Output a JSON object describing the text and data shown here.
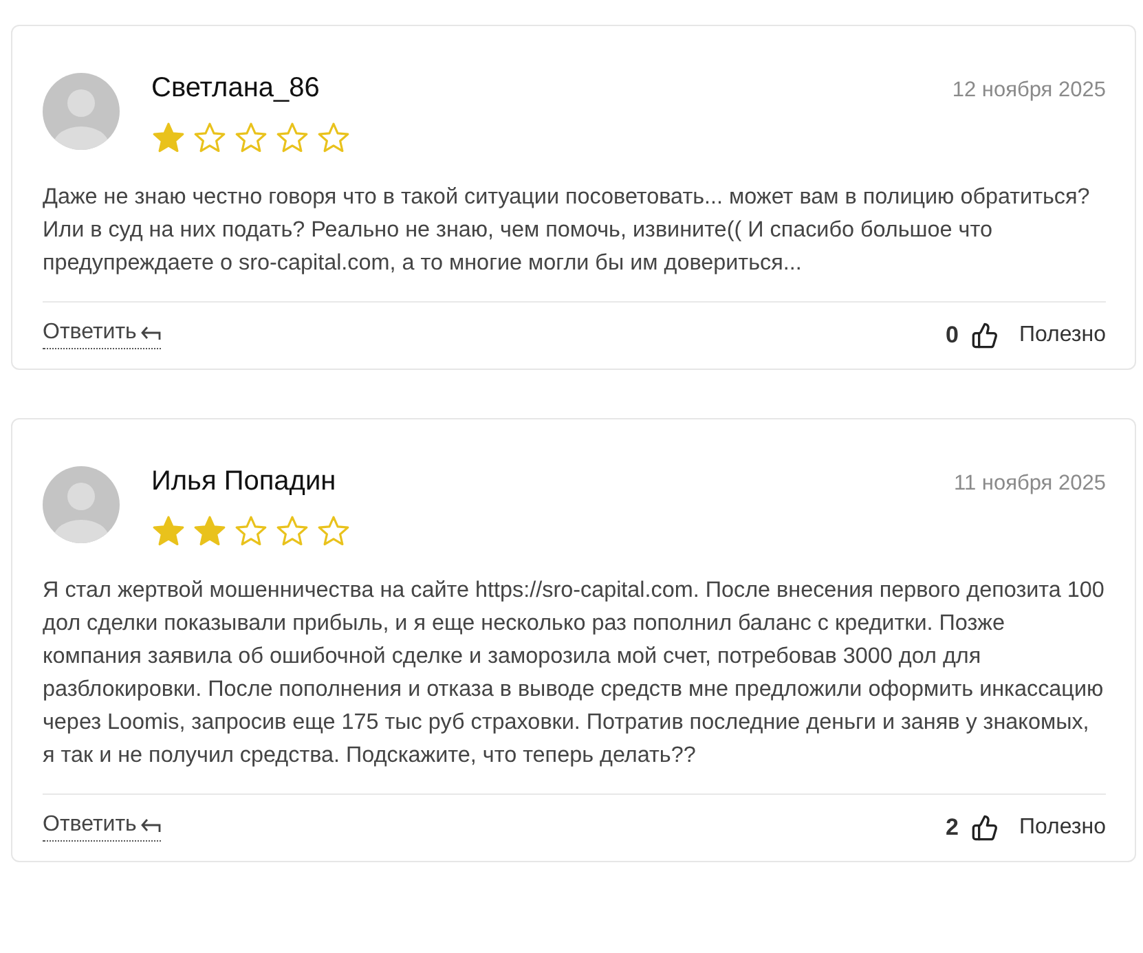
{
  "reviews": [
    {
      "author": "Светлана_86",
      "date": "12 ноября 2025",
      "stars": 1,
      "text": "Даже не знаю честно говоря что в такой ситуации посоветовать... может вам в полицию обратиться? Или в суд на них подать? Реально не знаю, чем помочь, извините(( И спасибо большое что предупреждаете о sro-capital.com, а то многие могли бы им довериться...",
      "reply": "Ответить",
      "likes": "0",
      "useful": "Полезно"
    },
    {
      "author": "Илья Попадин",
      "date": "11 ноября 2025",
      "stars": 2,
      "text": "Я стал жертвой мошенничества на сайте https://sro-capital.com. После внесения первого депозита 100 дол сделки показывали прибыль, и я еще несколько раз пополнил баланс с кредитки. Позже компания заявила об ошибочной сделке и заморозила мой счет, потребовав 3000 дол для разблокировки. После пополнения и отказа в выводе средств мне предложили оформить инкассацию через Loomis, запросив еще 175 тыс руб страховки. Потратив последние деньги и заняв у знакомых, я так и не получил средства. Подскажите, что теперь делать??",
      "reply": "Ответить",
      "likes": "2",
      "useful": "Полезно"
    }
  ]
}
